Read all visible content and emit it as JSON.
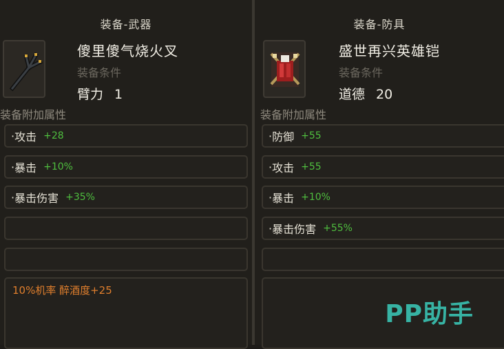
{
  "left": {
    "title": "装备-武器",
    "item_name": "傻里傻气烧火叉",
    "condition_label": "装备条件",
    "requirement": {
      "stat": "臂力",
      "value": "1"
    },
    "attr_heading": "装备附加属性",
    "attributes": [
      {
        "name": "攻击",
        "bonus": "+28"
      },
      {
        "name": "暴击",
        "bonus": "+10%"
      },
      {
        "name": "暴击伤害",
        "bonus": "+35%"
      }
    ],
    "special": "10%机率 醉酒度+25",
    "icon": "pitchfork-icon"
  },
  "right": {
    "title": "装备-防具",
    "item_name": "盛世再兴英雄铠",
    "condition_label": "装备条件",
    "requirement": {
      "stat": "道德",
      "value": "20"
    },
    "attr_heading": "装备附加属性",
    "attributes": [
      {
        "name": "防御",
        "bonus": "+55"
      },
      {
        "name": "攻击",
        "bonus": "+55"
      },
      {
        "name": "暴击",
        "bonus": "+10%"
      },
      {
        "name": "暴击伤害",
        "bonus": "+55%"
      }
    ],
    "icon": "armor-icon"
  },
  "watermark": "PP助手",
  "colors": {
    "bonus": "#4fbf3f",
    "special": "#e07f2d",
    "watermark": "#37b3a4"
  }
}
